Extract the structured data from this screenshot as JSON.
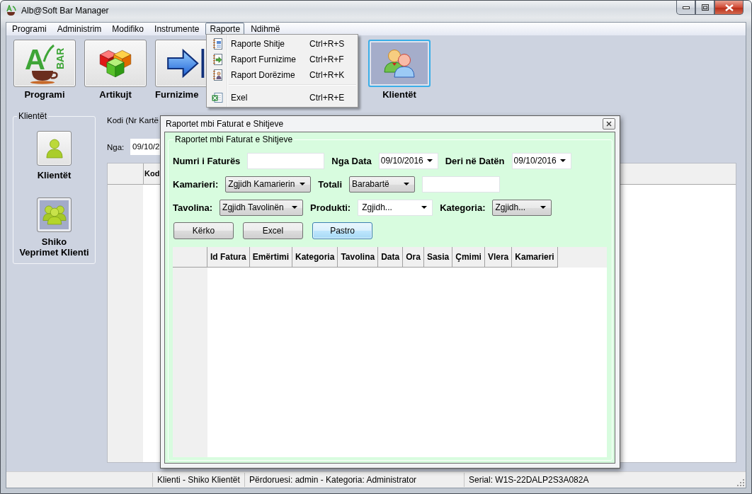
{
  "window": {
    "title": "Alb@Soft Bar Manager"
  },
  "menu_bar": [
    {
      "label": "Programi",
      "selected": false
    },
    {
      "label": "Administrim",
      "selected": false
    },
    {
      "label": "Modifiko",
      "selected": false
    },
    {
      "label": "Instrumente",
      "selected": false
    },
    {
      "label": "Raporte",
      "selected": true
    },
    {
      "label": "Ndihmë",
      "selected": false
    }
  ],
  "open_menu": {
    "items": [
      {
        "kind": "sales-report",
        "label": "Raporte Shitje",
        "shortcut": "Ctrl+R+S"
      },
      {
        "kind": "supply-report",
        "label": "Raport Furnizime",
        "shortcut": "Ctrl+R+F"
      },
      {
        "kind": "delivery-report",
        "label": "Raport Dorëzime",
        "shortcut": "Ctrl+R+K"
      },
      {
        "kind": "separator"
      },
      {
        "kind": "excel",
        "label": "Exel",
        "shortcut": "Ctrl+R+E"
      }
    ]
  },
  "toolbar": [
    {
      "kind": "logo",
      "logo": {
        "letter": "A",
        "word": "BAR"
      },
      "label": "Programi",
      "selected": false
    },
    {
      "kind": "cubes",
      "label": "Artikujt",
      "selected": false
    },
    {
      "kind": "arrow",
      "label": "Furnizime",
      "selected": false
    },
    {
      "kind": "users",
      "label": "Klientët",
      "selected": true
    }
  ],
  "sidebar": {
    "title": "Klientët",
    "items": [
      {
        "kind": "user",
        "label": "Klientët",
        "selected": false
      },
      {
        "kind": "group",
        "label": "Shiko\nVeprimet Klienti",
        "selected": true
      }
    ]
  },
  "form": {
    "code_label": "Kodi (Nr Kartë",
    "from_label": "Nga:",
    "from_value": "09/10/2",
    "grid": {
      "columns": [
        "Kod"
      ]
    }
  },
  "dialog": {
    "title": "Raportet mbi Faturat e Shitjeve",
    "group_title": "Raportet mbi Faturat e Shitjeve",
    "filter_rows": [
      [
        {
          "kind": "label",
          "text": "Numri i Faturës"
        },
        {
          "kind": "input"
        },
        {
          "kind": "label",
          "text": "Nga Data"
        },
        {
          "kind": "date",
          "value": "09/10/2016"
        },
        {
          "kind": "label",
          "text": "Deri në Datën"
        },
        {
          "kind": "date",
          "value": "09/10/2016"
        }
      ],
      [
        {
          "kind": "label",
          "text": "Kamarieri:"
        },
        {
          "kind": "combo",
          "value": "Zgjidh Kamarierin"
        },
        {
          "kind": "label",
          "text": "Totali"
        },
        {
          "kind": "combo",
          "value": "Barabartë"
        },
        {
          "kind": "input"
        }
      ],
      [
        {
          "kind": "label",
          "text": "Tavolina:"
        },
        {
          "kind": "combo",
          "value": "Zgjidh Tavolinën"
        },
        {
          "kind": "label",
          "text": "Produkti:"
        },
        {
          "kind": "editable-combo",
          "value": "Zgjidh..."
        },
        {
          "kind": "label",
          "text": "Kategoria:"
        },
        {
          "kind": "combo",
          "value": "Zgjidh..."
        }
      ]
    ],
    "buttons": [
      {
        "label": "Kërko",
        "focused": false
      },
      {
        "label": "Excel",
        "focused": false
      },
      {
        "label": "Pastro",
        "focused": true
      }
    ],
    "grid": {
      "columns": [
        "Id Fatura",
        "Emërtimi",
        "Kategoria",
        "Tavolina",
        "Data",
        "Ora",
        "Sasia",
        "Çmimi",
        "Vlera",
        "Kamarieri"
      ]
    }
  },
  "status_bar": [
    "Klienti - Shiko Klientët",
    "Përdoruesi: admin - Kategoria: Administrator",
    "Serial: W1S-22DALP2S3A082A"
  ]
}
